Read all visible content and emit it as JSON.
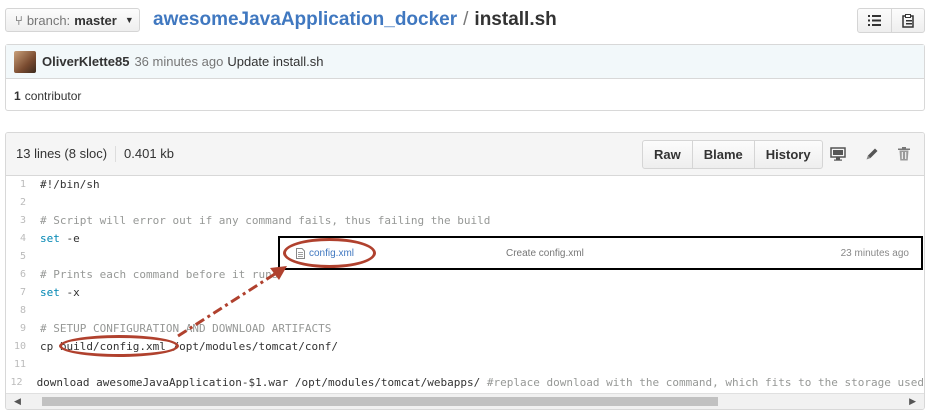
{
  "breadcrumb": {
    "branch_prefix": "branch:",
    "branch_name": "master",
    "repo": "awesomeJavaApplication_docker",
    "separator": "/",
    "file": "install.sh"
  },
  "commit": {
    "author": "OliverKlette85",
    "age": "36 minutes ago",
    "message": "Update install.sh",
    "contributor_count": "1",
    "contributor_label": "contributor"
  },
  "file_info": {
    "lines": "13 lines (8 sloc)",
    "size": "0.401 kb",
    "buttons": {
      "raw": "Raw",
      "blame": "Blame",
      "history": "History"
    }
  },
  "code_lines": [
    {
      "n": "1",
      "type": "plain",
      "text": "#!/bin/sh"
    },
    {
      "n": "2",
      "type": "plain",
      "text": ""
    },
    {
      "n": "3",
      "type": "comment",
      "text": "# Script will error out if any command fails, thus failing the build"
    },
    {
      "n": "4",
      "type": "kw",
      "kw": "set",
      "text": " -e"
    },
    {
      "n": "5",
      "type": "plain",
      "text": ""
    },
    {
      "n": "6",
      "type": "comment",
      "text": "# Prints each command before it runs"
    },
    {
      "n": "7",
      "type": "kw",
      "kw": "set",
      "text": " -x"
    },
    {
      "n": "8",
      "type": "plain",
      "text": ""
    },
    {
      "n": "9",
      "type": "comment",
      "text": "# SETUP CONFIGURATION AND DOWNLOAD ARTIFACTS"
    },
    {
      "n": "10",
      "type": "plain",
      "text": "cp build/config.xml /opt/modules/tomcat/conf/"
    },
    {
      "n": "11",
      "type": "plain",
      "text": ""
    },
    {
      "n": "12",
      "type": "mixed",
      "text": "download awesomeJavaApplication-$1.war /opt/modules/tomcat/webapps/ ",
      "comment": "#replace download with the command, which fits to the storage used"
    }
  ],
  "overlay": {
    "file_name": "config.xml",
    "commit_message": "Create config.xml",
    "age": "23 minutes ago"
  },
  "colors": {
    "link": "#4078c0",
    "annotation": "#b0412e",
    "comment": "#969896",
    "keyword": "#0086b3"
  }
}
